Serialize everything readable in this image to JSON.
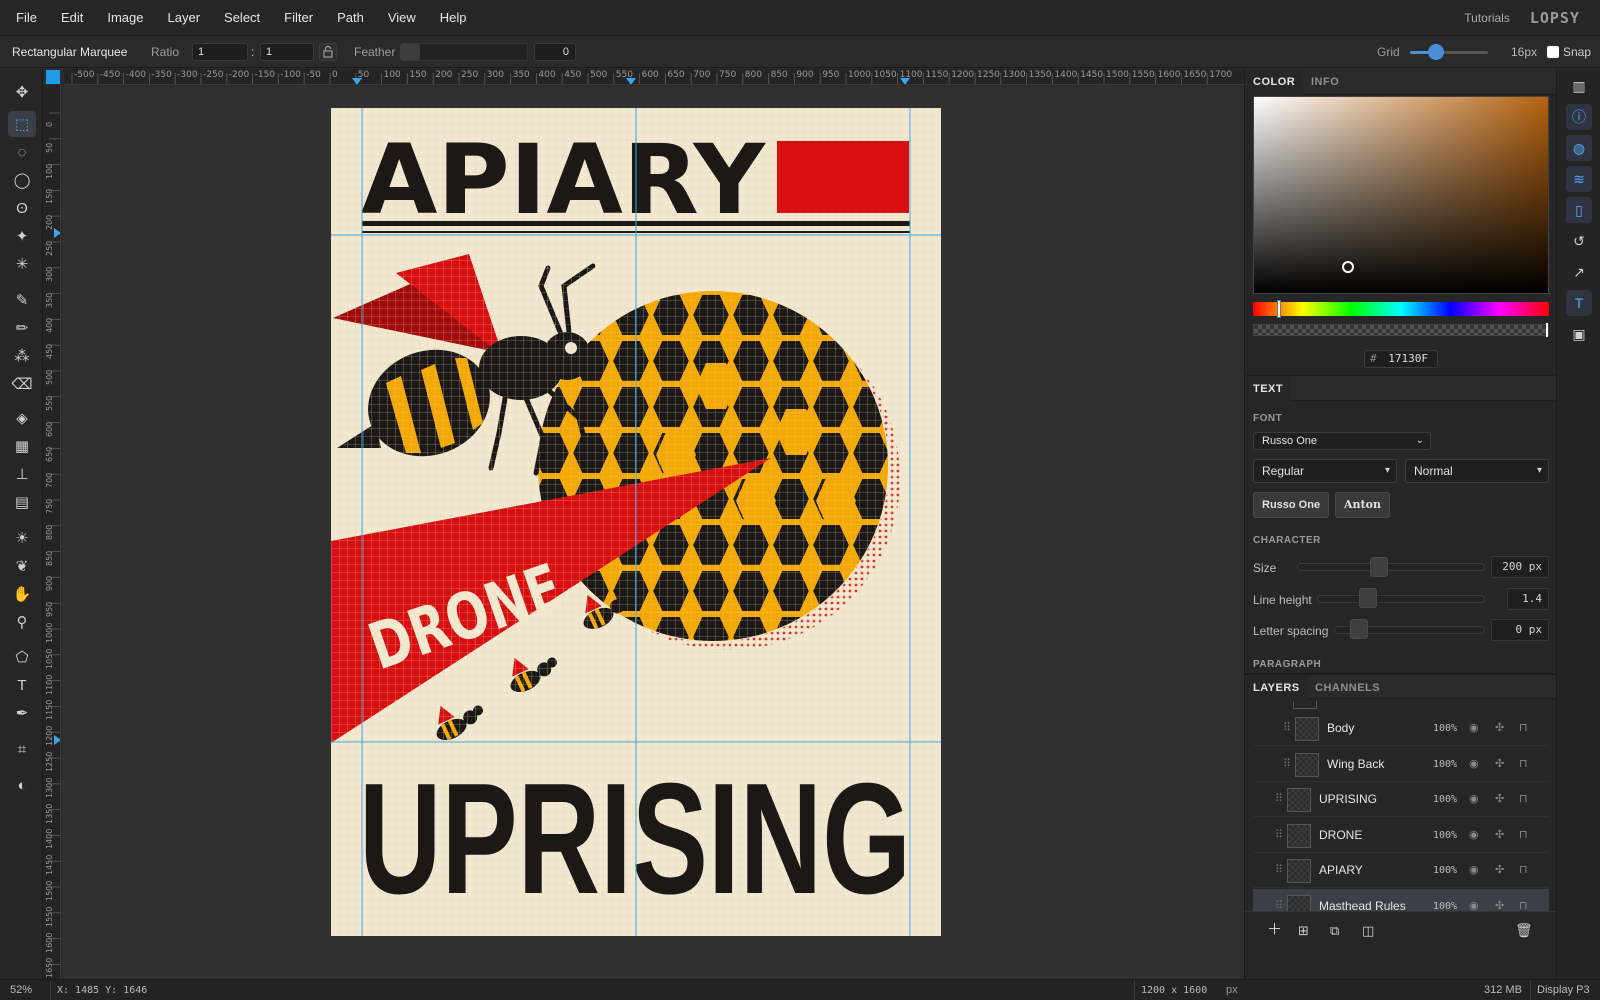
{
  "menu": [
    "File",
    "Edit",
    "Image",
    "Layer",
    "Select",
    "Filter",
    "Path",
    "View",
    "Help"
  ],
  "top_right": {
    "tutorials": "Tutorials",
    "logo": "LOPSY"
  },
  "options": {
    "tool_name": "Rectangular Marquee",
    "ratio_label": "Ratio",
    "ratio_w": "1",
    "ratio_sep": ":",
    "ratio_h": "1",
    "feather_label": "Feather",
    "feather_value": "0",
    "grid_label": "Grid",
    "grid_value": "16px",
    "snap_label": "Snap"
  },
  "tools": [
    {
      "icon": "move-icon",
      "glyph": "✥"
    },
    {
      "icon": "rect-marquee-icon",
      "glyph": "⬚"
    },
    {
      "icon": "ellipse-marquee-icon",
      "glyph": "◌"
    },
    {
      "icon": "lasso-icon",
      "glyph": "◯"
    },
    {
      "icon": "magnetic-lasso-icon",
      "glyph": "ʘ"
    },
    {
      "icon": "magic-wand-icon",
      "glyph": "✦"
    },
    {
      "icon": "quick-select-icon",
      "glyph": "✳"
    },
    {
      "icon": "brush-icon",
      "glyph": "✎"
    },
    {
      "icon": "pencil-icon",
      "glyph": "✏"
    },
    {
      "icon": "spray-icon",
      "glyph": "⁂"
    },
    {
      "icon": "eraser-icon",
      "glyph": "⌫"
    },
    {
      "icon": "bucket-icon",
      "glyph": "◈"
    },
    {
      "icon": "gradient-icon",
      "glyph": "▦"
    },
    {
      "icon": "stamp-icon",
      "glyph": "⊥"
    },
    {
      "icon": "pattern-icon",
      "glyph": "▤"
    },
    {
      "icon": "dodge-icon",
      "glyph": "☀"
    },
    {
      "icon": "burn-icon",
      "glyph": "❦"
    },
    {
      "icon": "hand-icon",
      "glyph": "✋"
    },
    {
      "icon": "eyedropper-icon",
      "glyph": "⚲"
    },
    {
      "icon": "polygon-icon",
      "glyph": "⬠"
    },
    {
      "icon": "text-icon",
      "glyph": "T"
    },
    {
      "icon": "pen-icon",
      "glyph": "✒"
    },
    {
      "icon": "crop-icon",
      "glyph": "⌗"
    },
    {
      "icon": "color-swap-icon",
      "glyph": "◐"
    }
  ],
  "ruler_top": [
    "-500",
    "-450",
    "-400",
    "-350",
    "-300",
    "-250",
    "-200",
    "-150",
    "-100",
    "-50",
    "0",
    "50",
    "100",
    "150",
    "200",
    "250",
    "300",
    "350",
    "400",
    "450",
    "500",
    "550",
    "600",
    "650",
    "700",
    "750",
    "800",
    "850",
    "900",
    "950",
    "1000",
    "1050",
    "1100",
    "1150",
    "1200",
    "1250",
    "1300",
    "1350",
    "1400",
    "1450",
    "1500",
    "1550",
    "1600",
    "1650",
    "1700"
  ],
  "ruler_left": [
    "0",
    "50",
    "100",
    "150",
    "200",
    "250",
    "300",
    "350",
    "400",
    "450",
    "500",
    "550",
    "600",
    "650",
    "700",
    "750",
    "800",
    "850",
    "900",
    "950",
    "1000",
    "1050",
    "1100",
    "1150",
    "1200",
    "1250",
    "1300",
    "1350",
    "1400",
    "1450",
    "1500",
    "1550",
    "1600",
    "1650"
  ],
  "poster": {
    "title": "APIARY",
    "banner": "DRONE",
    "bottom": "UPRISING",
    "colors": {
      "paper": "#f2e8cf",
      "ink": "#1c1815",
      "red": "#d90f0f",
      "gold": "#f5a800"
    }
  },
  "color_panel": {
    "tabs": [
      "COLOR",
      "INFO"
    ],
    "hex_prefix": "#",
    "hex": "17130F"
  },
  "text_panel": {
    "tab": "TEXT",
    "font_label": "FONT",
    "font_family": "Russo One",
    "style": "Regular",
    "weight": "Normal",
    "recent_fonts": [
      "Russo One",
      "Anton"
    ],
    "character_label": "CHARACTER",
    "size_label": "Size",
    "size_value": "200 px",
    "size_fraction": 0.43,
    "line_height_label": "Line height",
    "line_height_value": "1.4",
    "line_height_fraction": 0.28,
    "letter_spacing_label": "Letter spacing",
    "letter_spacing_value": "0 px",
    "letter_spacing_fraction": 0.12,
    "paragraph_label": "PARAGRAPH"
  },
  "layers_panel": {
    "tabs": [
      "LAYERS",
      "CHANNELS"
    ],
    "layers": [
      {
        "name": "Body",
        "opacity": "100%",
        "child": true,
        "selected": false
      },
      {
        "name": "Wing Back",
        "opacity": "100%",
        "child": true,
        "selected": false
      },
      {
        "name": "UPRISING",
        "opacity": "100%",
        "child": false,
        "selected": false
      },
      {
        "name": "DRONE",
        "opacity": "100%",
        "child": false,
        "selected": false
      },
      {
        "name": "APIARY",
        "opacity": "100%",
        "child": false,
        "selected": false
      },
      {
        "name": "Masthead Rules",
        "opacity": "100%",
        "child": false,
        "selected": true
      }
    ]
  },
  "status": {
    "zoom": "52%",
    "coords": "X: 1485 Y: 1646",
    "doc_size": "1200 x 1600",
    "doc_unit": "px",
    "memory": "312 MB",
    "profile": "Display P3"
  }
}
